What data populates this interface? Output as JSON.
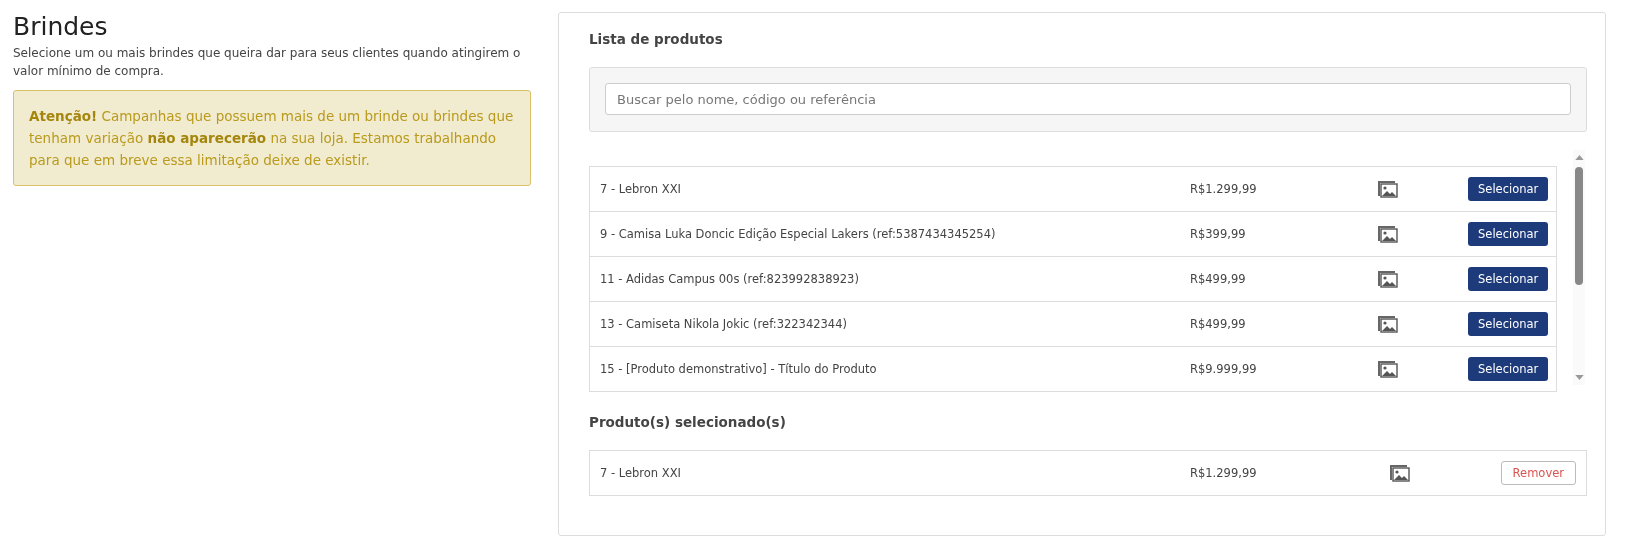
{
  "page": {
    "title": "Brindes",
    "description": "Selecione um ou mais brindes que queira dar para seus clientes quando atingirem o valor mínimo de compra.",
    "alert": "**Atenção!** Campanhas que possuem mais de um brinde ou brindes que tenham variação **não aparecerão** na sua loja. Estamos trabalhando para que em breve essa limitação deixe de existir."
  },
  "product_list": {
    "title": "Lista de produtos",
    "search": {
      "placeholder": "Buscar pelo nome, código ou referência"
    },
    "rows": [
      {
        "name": "7 - Lebron XXI",
        "price": "R$1.299,99",
        "action": "Selecionar"
      },
      {
        "name": "9 - Camisa Luka Doncic Edição Especial Lakers (ref:5387434345254)",
        "price": "R$399,99",
        "action": "Selecionar"
      },
      {
        "name": "11 - Adidas Campus 00s (ref:823992838923)",
        "price": "R$499,99",
        "action": "Selecionar"
      },
      {
        "name": "13 - Camiseta Nikola Jokic (ref:322342344)",
        "price": "R$499,99",
        "action": "Selecionar"
      },
      {
        "name": "15 - [Produto demonstrativo] - Título do Produto",
        "price": "R$9.999,99",
        "action": "Selecionar"
      }
    ]
  },
  "selected_products": {
    "title": "Produto(s) selecionado(s)",
    "rows": [
      {
        "name": "7 - Lebron XXI",
        "price": "R$1.299,99",
        "action": "Remover"
      }
    ]
  }
}
